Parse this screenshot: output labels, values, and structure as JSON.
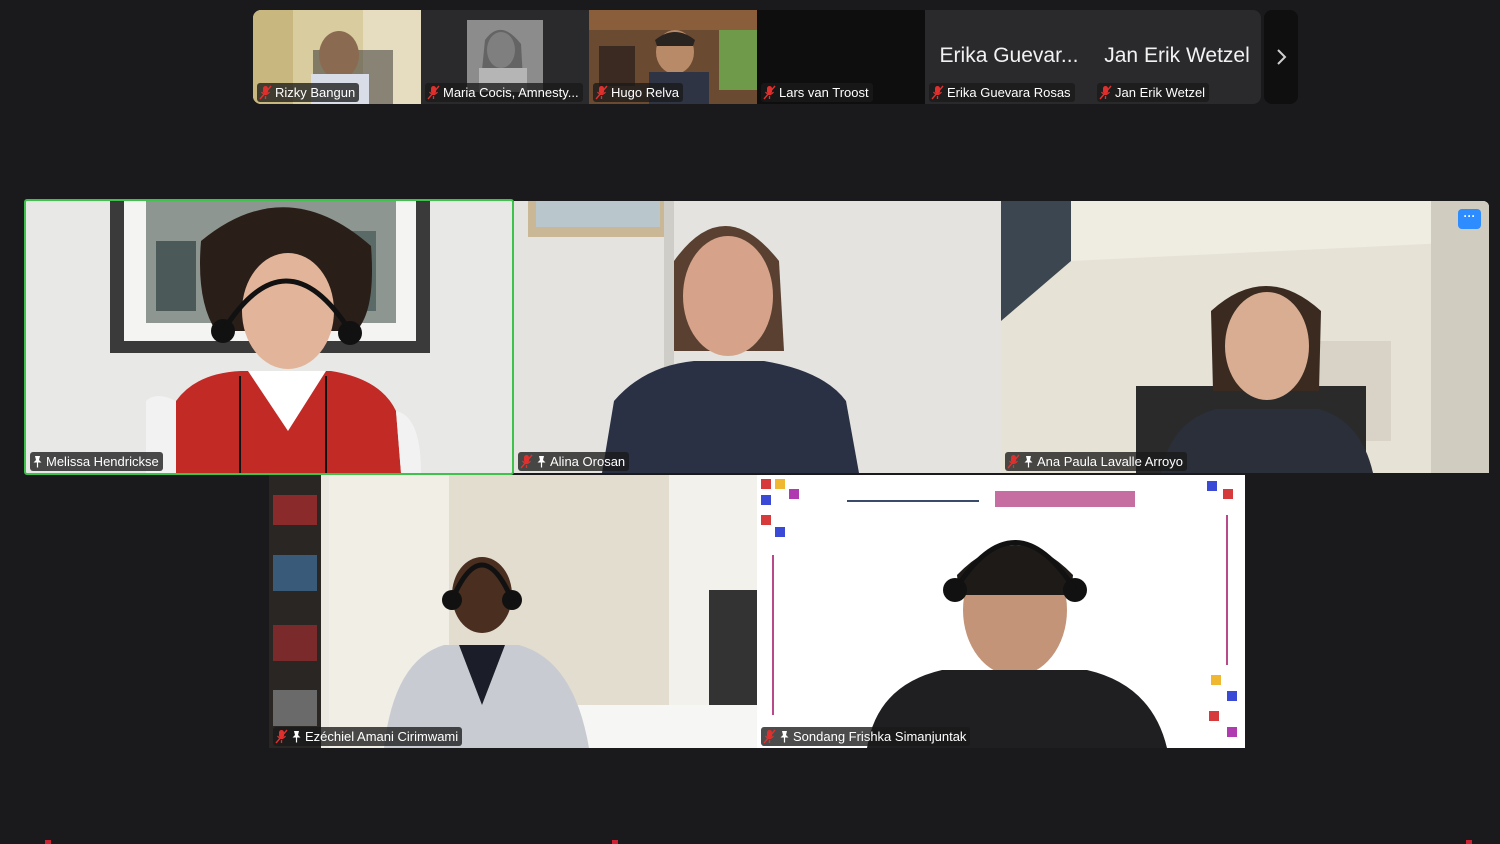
{
  "strip": {
    "tiles": [
      {
        "name": "Rizky Bangun",
        "type": "video"
      },
      {
        "name": "Maria Cocis, Amnesty...",
        "type": "video"
      },
      {
        "name": "Hugo Relva",
        "type": "video"
      },
      {
        "name": "Lars van Troost",
        "type": "blank"
      },
      {
        "name": "Erika Guevara Rosas",
        "display_name": "Erika Guevar...",
        "type": "avatar"
      },
      {
        "name": "Jan Erik Wetzel",
        "display_name": "Jan Erik Wetzel",
        "type": "avatar"
      }
    ],
    "next_icon": "chevron-right-icon"
  },
  "gallery": {
    "participants": [
      {
        "name": "Melissa Hendrickse",
        "muted": false,
        "pinned": true,
        "active_speaker": true
      },
      {
        "name": "Alina Orosan",
        "muted": true,
        "pinned": true
      },
      {
        "name": "Ana Paula Lavalle Arroyo",
        "muted": true,
        "pinned": true
      },
      {
        "name": "Ezéchiel Amani Cirimwami",
        "muted": true,
        "pinned": true
      },
      {
        "name": "Sondang Frishka Simanjuntak",
        "muted": true,
        "pinned": true
      }
    ],
    "more_button": "···"
  },
  "colors": {
    "background": "#1a1a1d",
    "active_speaker_border": "#3fc24b",
    "muted_icon": "#e0302e",
    "more_button": "#2d8cff"
  }
}
